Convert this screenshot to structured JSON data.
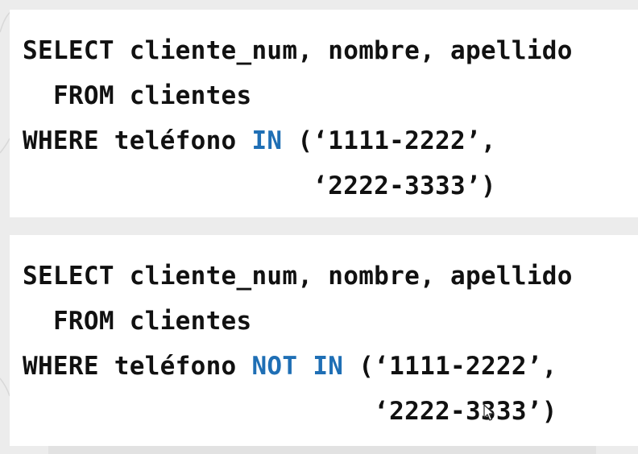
{
  "query1": {
    "line1": {
      "kw": "SELECT",
      "rest": " cliente_num, nombre, apellido"
    },
    "line2": {
      "indent": "  ",
      "kw": "FROM",
      "rest": " clientes"
    },
    "line3": {
      "kw": "WHERE",
      "mid": " teléfono ",
      "op": "IN",
      "rest": " (‘1111-2222’,"
    },
    "line4": {
      "text": "                   ‘2222-3333’)"
    }
  },
  "query2": {
    "line1": {
      "kw": "SELECT",
      "rest": " cliente_num, nombre, apellido"
    },
    "line2": {
      "indent": "  ",
      "kw": "FROM",
      "rest": " clientes"
    },
    "line3": {
      "kw": "WHERE",
      "mid": " teléfono ",
      "op1": "NOT",
      "sp": " ",
      "op2": "IN",
      "rest": " (‘1111-2222’,"
    },
    "line4": {
      "text": "                       ‘2222-3333’)"
    }
  },
  "colors": {
    "keyword": "#111111",
    "operator": "#1f6fb5",
    "card_bg": "#ffffff",
    "page_bg": "#ececec"
  },
  "icons": {
    "cursor": "mouse-pointer-icon"
  }
}
